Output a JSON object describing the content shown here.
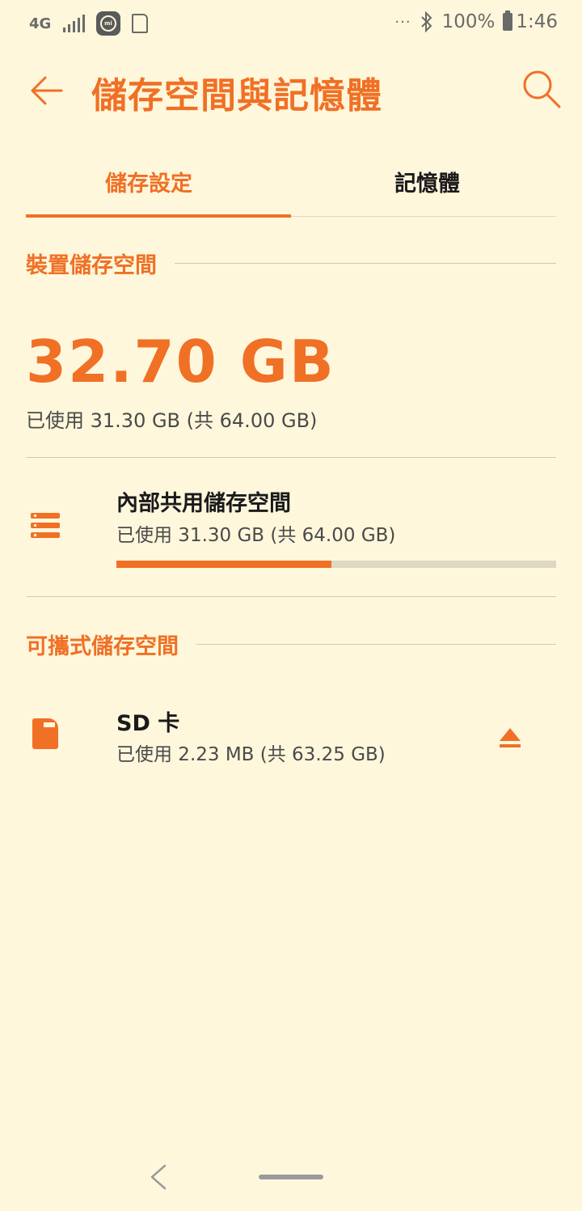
{
  "status_bar": {
    "network": "4G",
    "battery": "100%",
    "time": "1:46",
    "more": "···"
  },
  "app_bar": {
    "title": "儲存空間與記憶體",
    "back_icon": "arrow-left-icon",
    "search_icon": "search-icon"
  },
  "tabs": [
    {
      "label": "儲存設定",
      "active": true
    },
    {
      "label": "記憶體",
      "active": false
    }
  ],
  "device_storage": {
    "heading": "裝置儲存空間",
    "free_value": "32.70 GB",
    "used_summary": "已使用 31.30 GB (共 64.00 GB)"
  },
  "internal": {
    "title": "內部共用儲存空間",
    "subtitle": "已使用 31.30 GB (共 64.00 GB)",
    "used_fraction": 0.489
  },
  "portable": {
    "heading": "可攜式儲存空間",
    "sd_title": "SD 卡",
    "sd_subtitle": "已使用 2.23 MB (共 63.25 GB)"
  },
  "colors": {
    "accent": "#f07025",
    "background": "#fef7dc"
  }
}
